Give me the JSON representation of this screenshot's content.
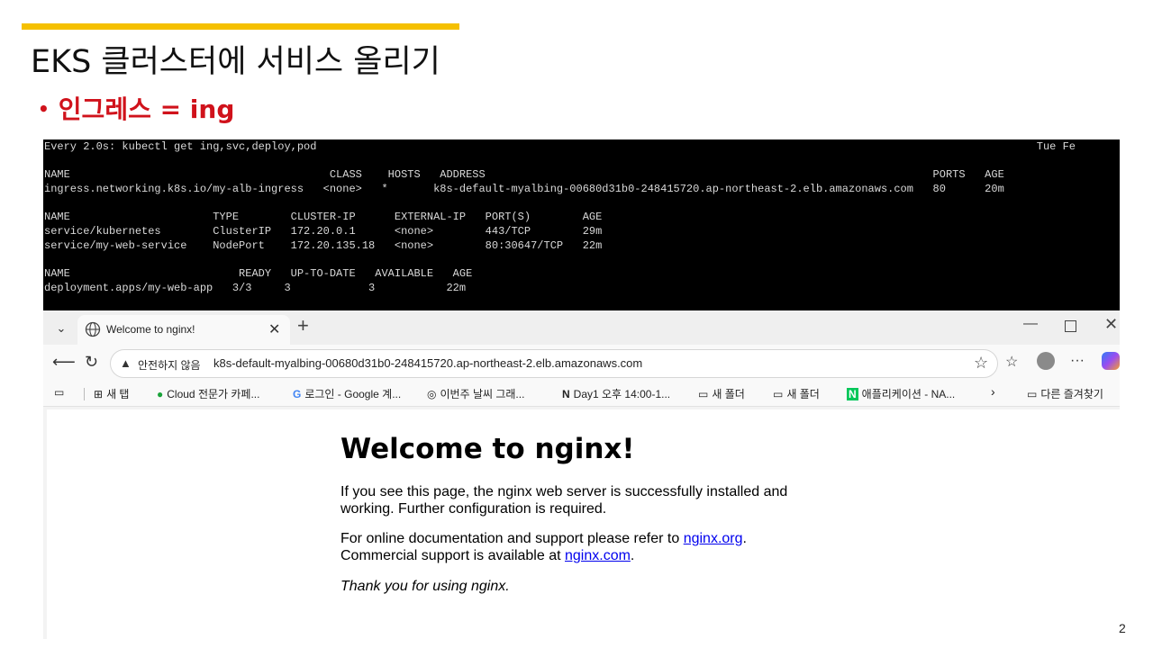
{
  "slide": {
    "title": "EKS 클러스터에 서비스 올리기",
    "bullet": "인그레스 = ing",
    "page_number": "2",
    "accent_color": "#f5c000",
    "bullet_color": "#d0121b"
  },
  "terminal": {
    "lines": [
      "Every 2.0s: kubectl get ing,svc,deploy,pod                                                                                                               Tue Fe",
      "",
      "NAME                                        CLASS    HOSTS   ADDRESS                                                                     PORTS   AGE",
      "ingress.networking.k8s.io/my-alb-ingress   <none>   *       k8s-default-myalbing-00680d31b0-248415720.ap-northeast-2.elb.amazonaws.com   80      20m",
      "",
      "NAME                      TYPE        CLUSTER-IP      EXTERNAL-IP   PORT(S)        AGE",
      "service/kubernetes        ClusterIP   172.20.0.1      <none>        443/TCP        29m",
      "service/my-web-service    NodePort    172.20.135.18   <none>        80:30647/TCP   22m",
      "",
      "NAME                          READY   UP-TO-DATE   AVAILABLE   AGE",
      "deployment.apps/my-web-app   3/3     3            3           22m"
    ]
  },
  "browser": {
    "tab_title": "Welcome to nginx!",
    "security_label": "안전하지 않음",
    "url": "k8s-default-myalbing-00680d31b0-248415720.ap-northeast-2.elb.amazonaws.com",
    "bookmarks": [
      {
        "label": "새 탭",
        "icon": "new-tab-icon"
      },
      {
        "label": "Cloud 전문가 카페...",
        "icon": "cafe-icon"
      },
      {
        "label": "로그인 - Google 계...",
        "icon": "google-icon"
      },
      {
        "label": "이번주 날씨 그래...",
        "icon": "globe-icon"
      },
      {
        "label": "Day1 오후 14:00-1...",
        "icon": "notion-icon"
      },
      {
        "label": "새 폴더",
        "icon": "folder-icon"
      },
      {
        "label": "새 폴더",
        "icon": "folder-icon"
      },
      {
        "label": "애플리케이션 - NA...",
        "icon": "naver-icon"
      }
    ],
    "other_favorites": "다른 즐겨찾기"
  },
  "nginx": {
    "heading": "Welcome to nginx!",
    "p1": "If you see this page, the nginx web server is successfully installed and working. Further configuration is required.",
    "p2_prefix": "For online documentation and support please refer to ",
    "p2_link": "nginx.org",
    "p2_mid": ".",
    "p2_line2_prefix": "Commercial support is available at ",
    "p2_link2": "nginx.com",
    "p2_suffix": ".",
    "p3": "Thank you for using nginx."
  }
}
